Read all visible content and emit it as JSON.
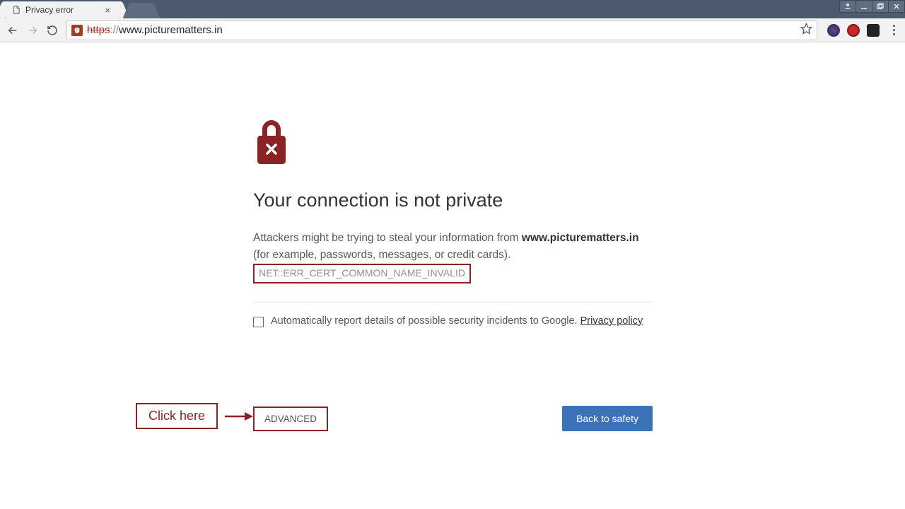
{
  "browser": {
    "tab_title": "Privacy error",
    "url_scheme": "https",
    "url_sep": "://",
    "url_rest": "www.picturematters.in"
  },
  "window_controls": {
    "incognito_title": "Incognito",
    "minimize_title": "Minimize",
    "maximize_title": "Maximize",
    "close_title": "Close"
  },
  "toolbar": {
    "back_title": "Back",
    "forward_title": "Forward",
    "reload_title": "Reload",
    "star_title": "Bookmark this page",
    "menu_title": "Customize and control Google Chrome"
  },
  "interstitial": {
    "heading": "Your connection is not private",
    "body_pre": "Attackers might be trying to steal your information from ",
    "body_domain": "www.picturematters.in",
    "body_post": " (for example, passwords, messages, or credit cards). ",
    "error_code": "NET::ERR_CERT_COMMON_NAME_INVALID",
    "report_label": "Automatically report details of possible security incidents to Google. ",
    "privacy_link": "Privacy policy",
    "advanced_label": "ADVANCED",
    "back_label": "Back to safety"
  },
  "annotation": {
    "label": "Click here"
  }
}
